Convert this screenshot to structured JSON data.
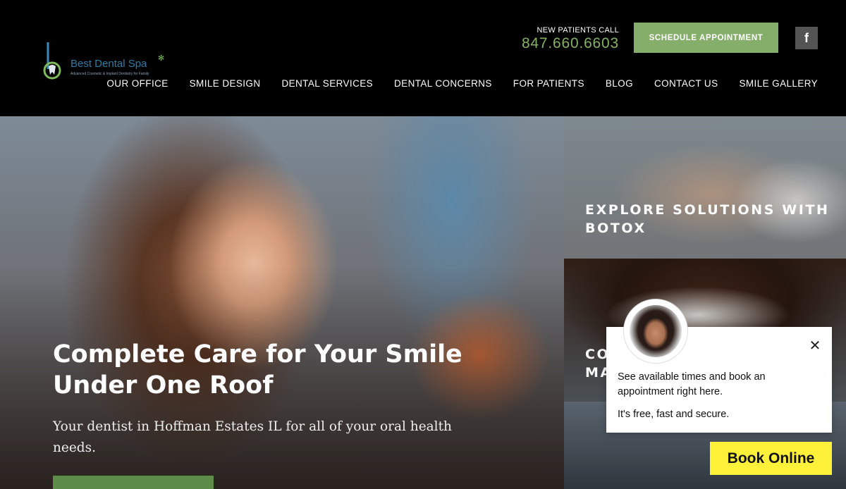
{
  "brand": {
    "name": "Best Dental Spa",
    "tagline": "Advanced Cosmetic & Implant Dentistry for Family"
  },
  "header": {
    "call_label": "NEW PATIENTS CALL",
    "phone": "847.660.6603",
    "schedule_label": "SCHEDULE APPOINTMENT",
    "facebook_label": "f"
  },
  "nav": {
    "items": [
      {
        "label": "OUR OFFICE"
      },
      {
        "label": "SMILE DESIGN"
      },
      {
        "label": "DENTAL SERVICES"
      },
      {
        "label": "DENTAL CONCERNS"
      },
      {
        "label": "FOR PATIENTS"
      },
      {
        "label": "BLOG"
      },
      {
        "label": "CONTACT US"
      },
      {
        "label": "SMILE GALLERY"
      }
    ]
  },
  "hero": {
    "title": "Complete Care for Your Smile Under One Roof",
    "subtitle": "Your dentist in Hoffman Estates IL for all of your oral health needs."
  },
  "panels": {
    "botox": "EXPLORE SOLUTIONS WITH BOTOX",
    "smile_partial": "CO\nMA"
  },
  "chat": {
    "line1": "See available times and book an appointment right here.",
    "line2": "It's free, fast and secure.",
    "close": "✕",
    "book_label": "Book Online"
  },
  "colors": {
    "accent_green": "#85ae6b",
    "phone_green": "#86b063",
    "book_yellow": "#fff03a",
    "header_bg": "#000000"
  }
}
